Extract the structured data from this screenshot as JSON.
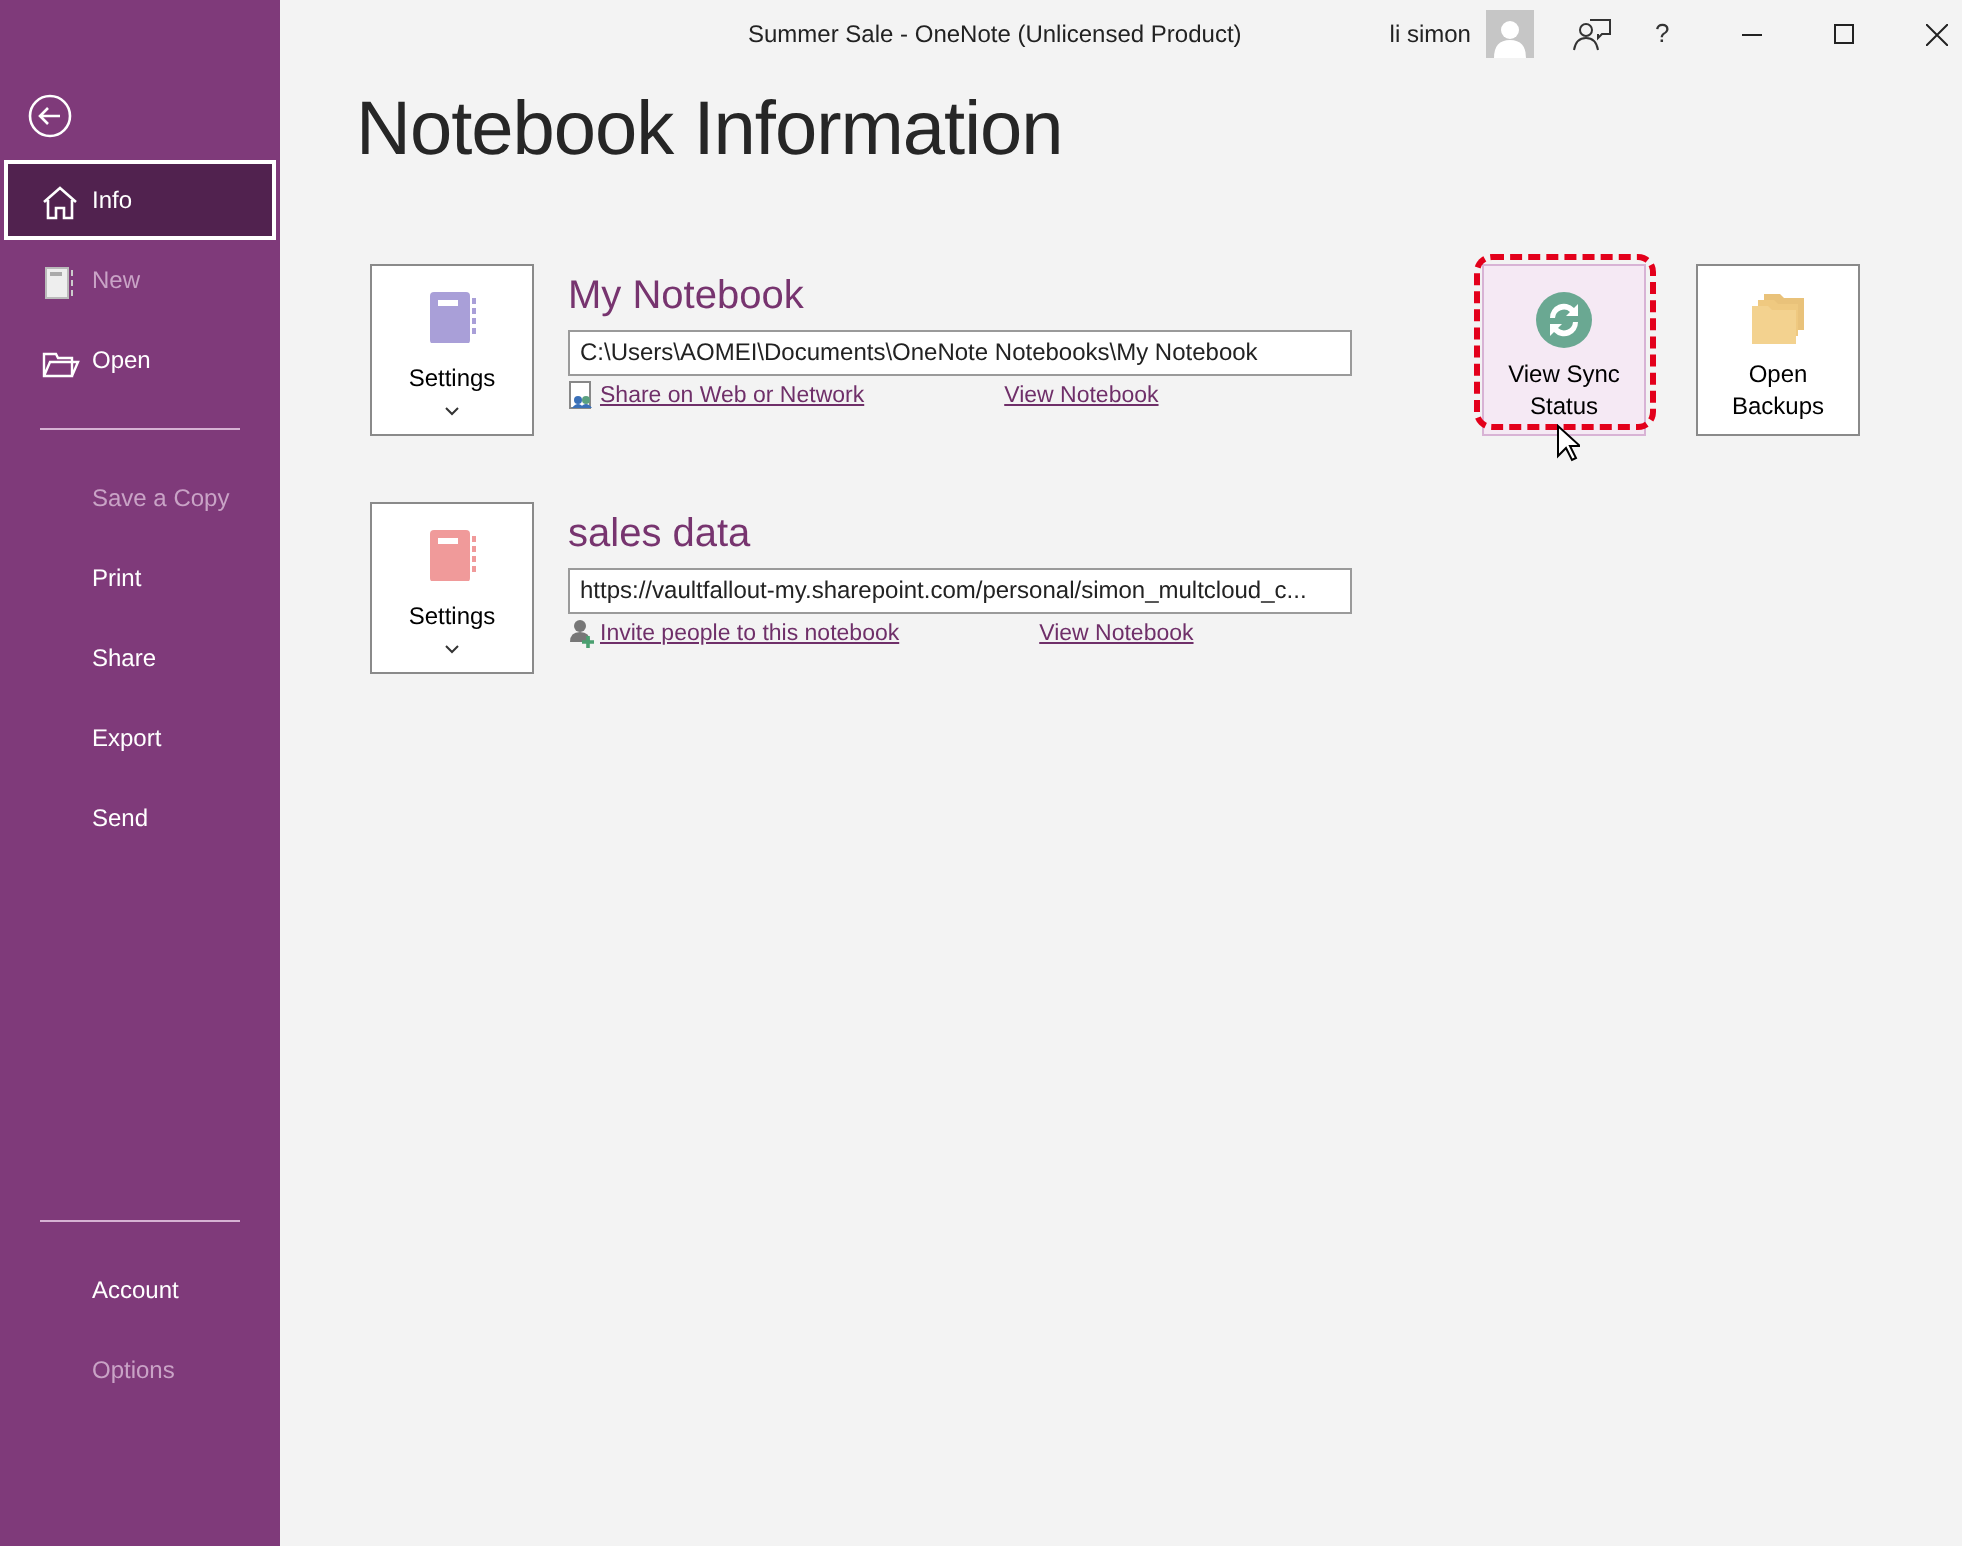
{
  "window": {
    "title": "Summer Sale  -  OneNote (Unlicensed Product)",
    "user_name": "li simon",
    "help": "?"
  },
  "sidebar": {
    "groups": [
      [
        {
          "label": "Info",
          "kind": "home",
          "selected": true,
          "disabled": false
        },
        {
          "label": "New",
          "kind": "page",
          "selected": false,
          "disabled": true
        },
        {
          "label": "Open",
          "kind": "folder",
          "selected": false,
          "disabled": false
        }
      ],
      [
        {
          "label": "Save a Copy",
          "selected": false,
          "disabled": true
        },
        {
          "label": "Print",
          "selected": false,
          "disabled": false
        },
        {
          "label": "Share",
          "selected": false,
          "disabled": false
        },
        {
          "label": "Export",
          "selected": false,
          "disabled": false
        },
        {
          "label": "Send",
          "selected": false,
          "disabled": false
        }
      ],
      [
        {
          "label": "Account",
          "selected": false,
          "disabled": false
        },
        {
          "label": "Options",
          "selected": false,
          "disabled": true
        }
      ]
    ]
  },
  "page_title": "Notebook Information",
  "notebooks": [
    {
      "name": "My Notebook",
      "color": "#a99fd8",
      "settings_label": "Settings",
      "path": "C:\\Users\\AOMEI\\Documents\\OneNote Notebooks\\My Notebook",
      "share": {
        "kind": "share",
        "label": "Share on Web or Network"
      },
      "view_label": "View Notebook"
    },
    {
      "name": "sales data",
      "color": "#f09a9a",
      "settings_label": "Settings",
      "path": "https://vaultfallout-my.sharepoint.com/personal/simon_multcloud_c...",
      "share": {
        "kind": "invite",
        "label": "Invite people to this notebook"
      },
      "view_label": "View Notebook"
    }
  ],
  "actions": [
    {
      "label": "View Sync Status",
      "kind": "sync",
      "highlighted": true,
      "hovered": true
    },
    {
      "label": "Open Backups",
      "kind": "folders",
      "highlighted": false,
      "hovered": false
    }
  ]
}
